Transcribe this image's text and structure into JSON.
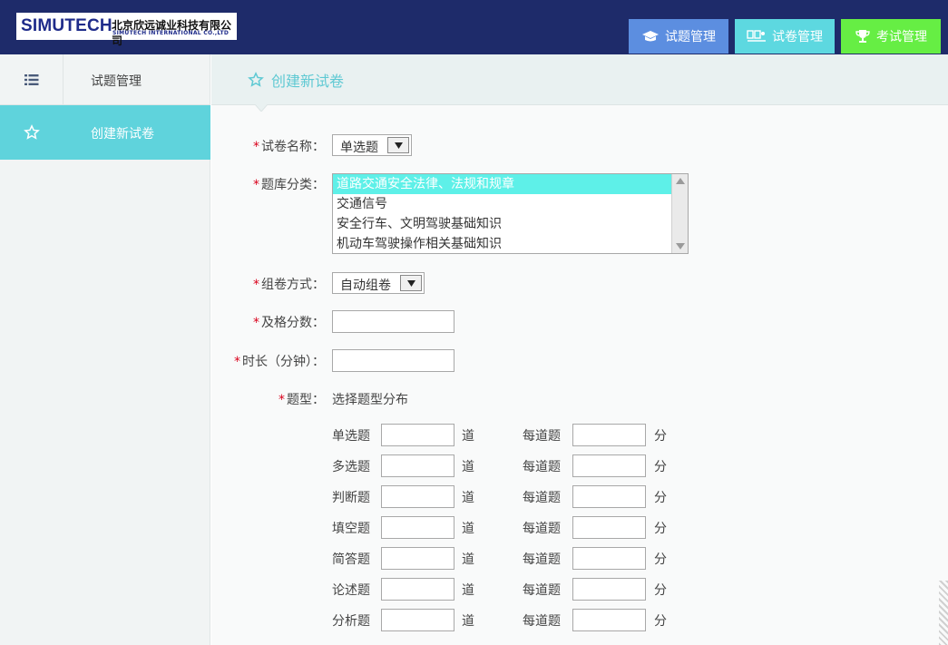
{
  "header": {
    "logo_main": "SIMUTECH",
    "logo_cn": "北京欣远诚业科技有限公司",
    "logo_en": "SIMUTECH INTERNATIONAL CO.,LTD",
    "nav": [
      {
        "label": "试题管理",
        "icon": "graduation-cap-icon",
        "color": "#5c8ee0"
      },
      {
        "label": "试卷管理",
        "icon": "paper-icon",
        "color": "#5dd8e0"
      },
      {
        "label": "考试管理",
        "icon": "trophy-icon",
        "color": "#66ee44"
      }
    ]
  },
  "sidebar": {
    "head_label": "试题管理",
    "items": [
      {
        "label": "创建新试卷",
        "icon": "star-icon",
        "active": true
      }
    ]
  },
  "content": {
    "title": "创建新试卷"
  },
  "form": {
    "required_mark": "*",
    "paper_name_label": "试卷名称：",
    "paper_name_value": "单选题",
    "category_label": "题库分类：",
    "category_options": [
      "道路交通安全法律、法规和规章",
      "交通信号",
      "安全行车、文明驾驶基础知识",
      "机动车驾驶操作相关基础知识"
    ],
    "category_selected_index": 0,
    "compose_label": "组卷方式：",
    "compose_value": "自动组卷",
    "pass_label": "及格分数：",
    "duration_label": "时长（分钟）：",
    "qtype_label": "题型：",
    "qtype_hint": "选择题型分布",
    "question_types": [
      {
        "name": "单选题",
        "unit": "道",
        "per_label": "每道题",
        "score_unit": "分"
      },
      {
        "name": "多选题",
        "unit": "道",
        "per_label": "每道题",
        "score_unit": "分"
      },
      {
        "name": "判断题",
        "unit": "道",
        "per_label": "每道题",
        "score_unit": "分"
      },
      {
        "name": "填空题",
        "unit": "道",
        "per_label": "每道题",
        "score_unit": "分"
      },
      {
        "name": "简答题",
        "unit": "道",
        "per_label": "每道题",
        "score_unit": "分"
      },
      {
        "name": "论述题",
        "unit": "道",
        "per_label": "每道题",
        "score_unit": "分"
      },
      {
        "name": "分析题",
        "unit": "道",
        "per_label": "每道题",
        "score_unit": "分"
      }
    ]
  },
  "colors": {
    "header_bg": "#1e2b6a",
    "accent": "#5fd3dc",
    "required": "#d9001b",
    "list_selected": "#5ef0e8"
  }
}
